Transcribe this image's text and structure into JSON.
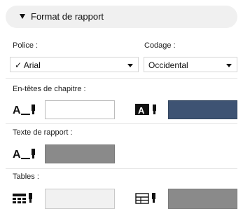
{
  "section": {
    "title": "Format de rapport"
  },
  "police": {
    "label": "Police :",
    "value": "Arial",
    "check": "✓"
  },
  "codage": {
    "label": "Codage :",
    "value": "Occidental"
  },
  "chapter_headers": {
    "label": "En-têtes de chapitre :"
  },
  "report_text": {
    "label": "Texte de rapport :"
  },
  "tables": {
    "label": "Tables :"
  },
  "colors": {
    "header_bg": "#f0f0f0",
    "navy": "#3e5373",
    "gray": "#8a8a8a"
  },
  "icons": [
    "text-color-icon",
    "text-highlight-icon",
    "table-header-color-icon",
    "table-grid-color-icon"
  ]
}
